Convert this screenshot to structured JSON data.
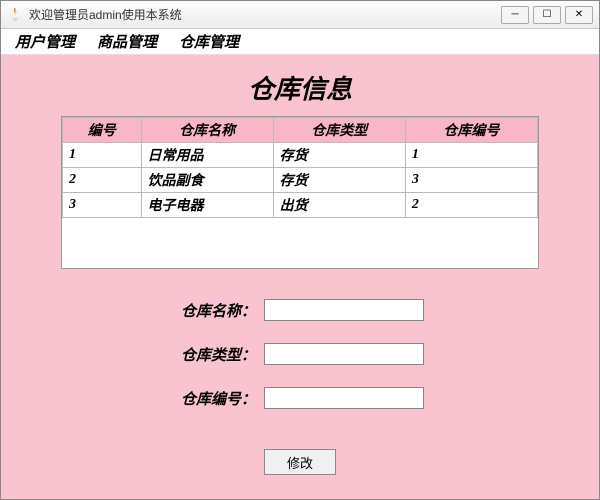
{
  "window": {
    "title": "欢迎管理员admin使用本系统"
  },
  "menubar": {
    "items": [
      "用户管理",
      "商品管理",
      "仓库管理"
    ]
  },
  "page": {
    "heading": "仓库信息"
  },
  "table": {
    "headers": [
      "编号",
      "仓库名称",
      "仓库类型",
      "仓库编号"
    ],
    "rows": [
      [
        "1",
        "日常用品",
        "存货",
        "1"
      ],
      [
        "2",
        "饮品副食",
        "存货",
        "3"
      ],
      [
        "3",
        "电子电器",
        "出货",
        "2"
      ]
    ]
  },
  "form": {
    "fields": [
      {
        "label": "仓库名称：",
        "value": ""
      },
      {
        "label": "仓库类型：",
        "value": ""
      },
      {
        "label": "仓库编号：",
        "value": ""
      }
    ],
    "submit_label": "修改"
  }
}
